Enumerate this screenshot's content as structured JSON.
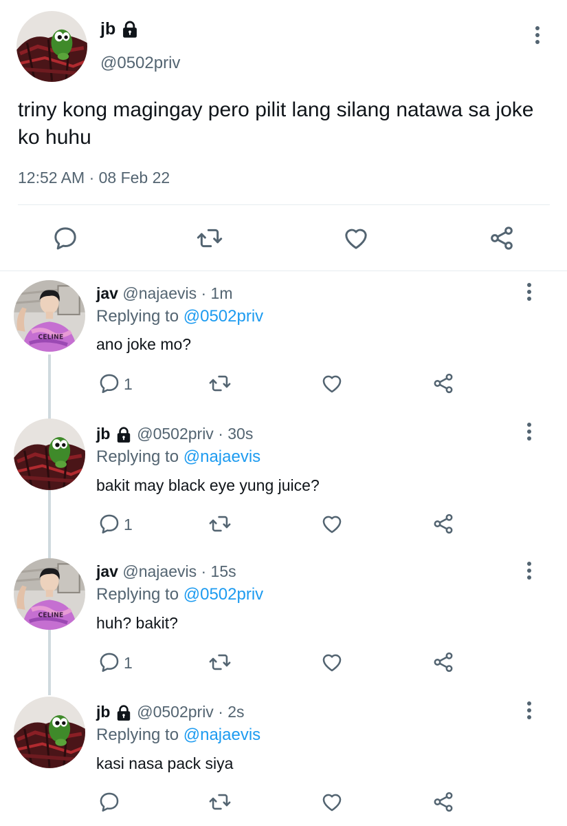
{
  "main_tweet": {
    "name": "jb",
    "handle": "@0502priv",
    "text": "triny kong magingay pero pilit lang silang natawa sa joke ko huhu",
    "timestamp": "12:52 AM · 08 Feb 22",
    "actions": [
      "reply-icon",
      "retweet-icon",
      "like-icon",
      "share-icon"
    ]
  },
  "replies": [
    {
      "name": "jav",
      "handle": "@najaevis",
      "time": "· 1m",
      "replying_label": "Replying to",
      "replying_to": "@0502priv",
      "text": "ano joke mo?",
      "reply_count": "1",
      "locked": false
    },
    {
      "name": "jb",
      "handle": "@0502priv",
      "time": "· 30s",
      "replying_label": "Replying to",
      "replying_to": "@najaevis",
      "text": "bakit may black eye yung juice?",
      "reply_count": "1",
      "locked": true
    },
    {
      "name": "jav",
      "handle": "@najaevis",
      "time": "· 15s",
      "replying_label": "Replying to",
      "replying_to": "@0502priv",
      "text": "huh? bakit?",
      "reply_count": "1",
      "locked": false
    },
    {
      "name": "jb",
      "handle": "@0502priv",
      "time": "· 2s",
      "replying_label": "Replying to",
      "replying_to": "@najaevis",
      "text": "kasi nasa pack siya",
      "reply_count": "",
      "locked": true
    }
  ],
  "colors": {
    "text": "#0f1419",
    "secondary": "#536471",
    "link": "#1d9bf0",
    "divider": "#e6ecf0"
  }
}
